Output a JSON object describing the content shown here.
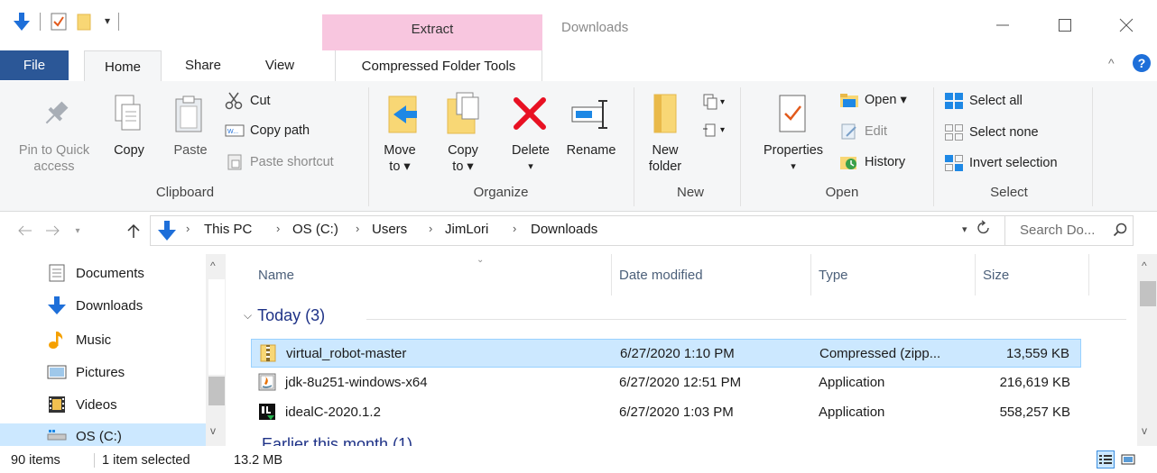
{
  "title_bar": {
    "context_tab_group": "Extract",
    "window_title": "Downloads",
    "minimize_icon": "minimize-icon",
    "maximize_icon": "maximize-icon",
    "close_icon": "close-icon"
  },
  "tabs": {
    "file": "File",
    "home": "Home",
    "share": "Share",
    "view": "View",
    "compressed": "Compressed Folder Tools"
  },
  "ribbon": {
    "clipboard": {
      "label": "Clipboard",
      "pin_line1": "Pin to Quick",
      "pin_line2": "access",
      "copy": "Copy",
      "paste": "Paste",
      "cut": "Cut",
      "copy_path": "Copy path",
      "paste_shortcut": "Paste shortcut"
    },
    "organize": {
      "label": "Organize",
      "move_line1": "Move",
      "move_line2": "to ▾",
      "copy_line1": "Copy",
      "copy_line2": "to ▾",
      "delete": "Delete",
      "delete_arrow": "▾",
      "rename": "Rename"
    },
    "new": {
      "label": "New",
      "new_folder_line1": "New",
      "new_folder_line2": "folder"
    },
    "open": {
      "label": "Open",
      "properties": "Properties",
      "properties_arrow": "▾",
      "open": "Open ▾",
      "edit": "Edit",
      "history": "History"
    },
    "select": {
      "label": "Select",
      "select_all": "Select all",
      "select_none": "Select none",
      "invert": "Invert selection"
    }
  },
  "address": {
    "crumbs": [
      "This PC",
      "OS (C:)",
      "Users",
      "JimLori",
      "Downloads"
    ],
    "search_placeholder": "Search Do..."
  },
  "nav_pane": {
    "items": [
      {
        "label": "Documents",
        "icon": "documents-icon"
      },
      {
        "label": "Downloads",
        "icon": "downloads-icon"
      },
      {
        "label": "Music",
        "icon": "music-icon"
      },
      {
        "label": "Pictures",
        "icon": "pictures-icon"
      },
      {
        "label": "Videos",
        "icon": "videos-icon"
      },
      {
        "label": "OS (C:)",
        "icon": "drive-icon"
      }
    ]
  },
  "file_list": {
    "columns": {
      "name": "Name",
      "date": "Date modified",
      "type": "Type",
      "size": "Size"
    },
    "group_today": "Today (3)",
    "group_partial": "Earlier this month (1)",
    "rows": [
      {
        "name": "virtual_robot-master",
        "date": "6/27/2020 1:10 PM",
        "type": "Compressed (zipp...",
        "size": "13,559 KB",
        "icon": "zip-folder-icon"
      },
      {
        "name": "jdk-8u251-windows-x64",
        "date": "6/27/2020 12:51 PM",
        "type": "Application",
        "size": "216,619 KB",
        "icon": "java-installer-icon"
      },
      {
        "name": "idealC-2020.1.2",
        "date": "6/27/2020 1:03 PM",
        "type": "Application",
        "size": "558,257 KB",
        "icon": "intellij-icon"
      }
    ]
  },
  "status_bar": {
    "items": "90 items",
    "selected": "1 item selected",
    "size": "13.2 MB"
  },
  "colors": {
    "file_tab": "#2b5797",
    "context_tab": "#f8c6df",
    "selection": "#cce8ff",
    "selection_border": "#99d1ff",
    "delete_red": "#e81123",
    "folder_yellow": "#f8d775"
  }
}
